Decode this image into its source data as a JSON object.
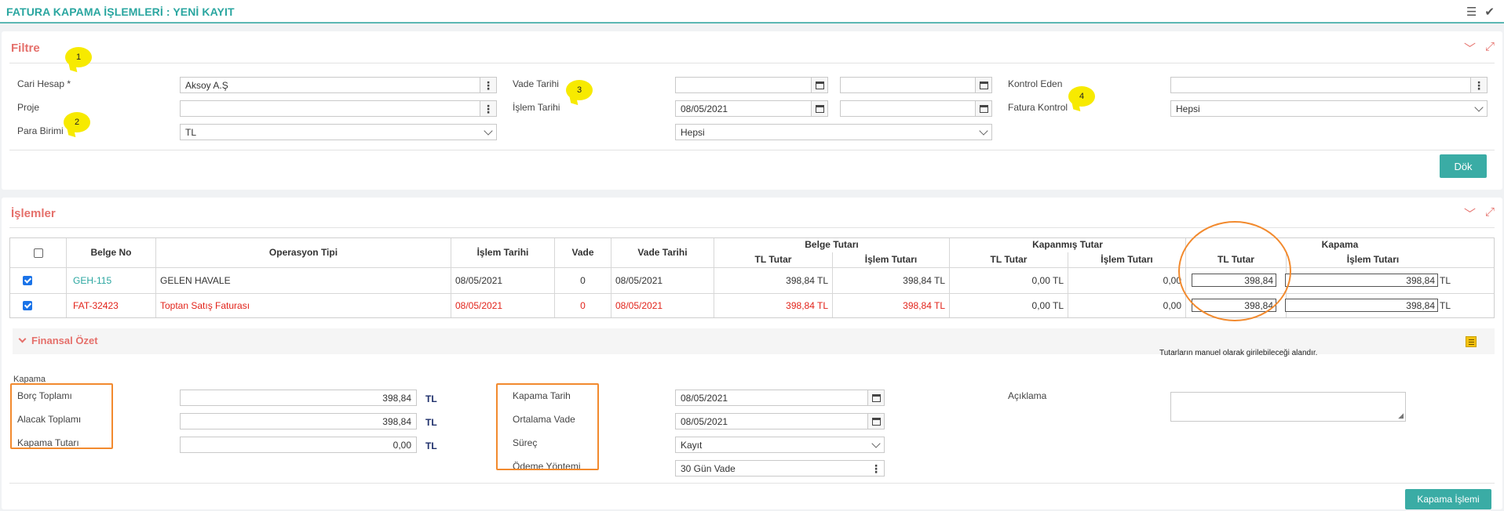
{
  "header": {
    "title": "FATURA KAPAMA İŞLEMLERİ : YENİ KAYIT"
  },
  "filter": {
    "title": "Filtre",
    "cari_hesap": {
      "label": "Cari Hesap *",
      "value": "Aksoy A.Ş"
    },
    "proje": {
      "label": "Proje",
      "value": ""
    },
    "para_birimi": {
      "label": "Para Birimi",
      "value": "TL"
    },
    "vade_tarihi": {
      "label": "Vade Tarihi",
      "start": "",
      "end": ""
    },
    "islem_tarihi": {
      "label": "İşlem Tarihi",
      "start": "08/05/2021",
      "end": ""
    },
    "status_select": {
      "value": "Hepsi"
    },
    "kontrol_eden": {
      "label": "Kontrol Eden",
      "value": ""
    },
    "fatura_kontrol": {
      "label": "Fatura Kontrol",
      "value": "Hepsi"
    },
    "dok_button": "Dök",
    "callouts": [
      "1",
      "2",
      "3",
      "4"
    ]
  },
  "islemler": {
    "title": "İşlemler",
    "columns": {
      "belge_no": "Belge No",
      "operasyon_tipi": "Operasyon Tipi",
      "islem_tarihi": "İşlem Tarihi",
      "vade": "Vade",
      "vade_tarihi": "Vade Tarihi",
      "belge_tutari": "Belge Tutarı",
      "kapanmis_tutar": "Kapanmış Tutar",
      "kapama": "Kapama",
      "tl_tutar": "TL Tutar",
      "islem_tutari": "İşlem Tutarı"
    },
    "rows": [
      {
        "checked": true,
        "belge_no": "GEH-115",
        "operasyon_tipi": "GELEN HAVALE",
        "islem_tarihi": "08/05/2021",
        "vade": "0",
        "vade_tarihi": "08/05/2021",
        "belge_tl": "398,84 TL",
        "belge_islem": "398,84 TL",
        "kapanmis_tl": "0,00 TL",
        "kapanmis_islem": "0,00",
        "kapama_tl": "398,84",
        "kapama_islem": "398,84",
        "currency": "TL"
      },
      {
        "checked": true,
        "belge_no": "FAT-32423",
        "operasyon_tipi": "Toptan Satış Faturası",
        "islem_tarihi": "08/05/2021",
        "vade": "0",
        "vade_tarihi": "08/05/2021",
        "belge_tl": "398,84 TL",
        "belge_islem": "398,84 TL",
        "kapanmis_tl": "0,00 TL",
        "kapanmis_islem": "0,00",
        "kapama_tl": "398,84",
        "kapama_islem": "398,84",
        "currency": "TL"
      }
    ],
    "colors": {
      "row2_text": "#e2231a",
      "link": "#2aa6a0"
    }
  },
  "finansal_ozet": {
    "title": "Finansal Özet",
    "note": "Tutarların manuel olarak girilebileceği alandır."
  },
  "kapama": {
    "section_label": "Kapama",
    "borc_toplami": {
      "label": "Borç Toplamı",
      "value": "398,84",
      "currency": "TL"
    },
    "alacak_toplami": {
      "label": "Alacak Toplamı",
      "value": "398,84",
      "currency": "TL"
    },
    "kapama_tutari": {
      "label": "Kapama Tutarı",
      "value": "0,00",
      "currency": "TL"
    },
    "kapama_tarih": {
      "label": "Kapama Tarih",
      "value": "08/05/2021"
    },
    "ortalama_vade": {
      "label": "Ortalama Vade",
      "value": "08/05/2021"
    },
    "surec": {
      "label": "Süreç",
      "value": "Kayıt"
    },
    "odeme_yontemi": {
      "label": "Ödeme Yöntemi",
      "value": "30 Gün Vade"
    },
    "aciklama": {
      "label": "Açıklama",
      "value": ""
    },
    "button": "Kapama İşlemi"
  },
  "accent_colors": {
    "teal": "#3aaca5",
    "salmon": "#e5706b",
    "orange_highlight": "#f28a2e",
    "callout_yellow": "#f7ea00"
  }
}
